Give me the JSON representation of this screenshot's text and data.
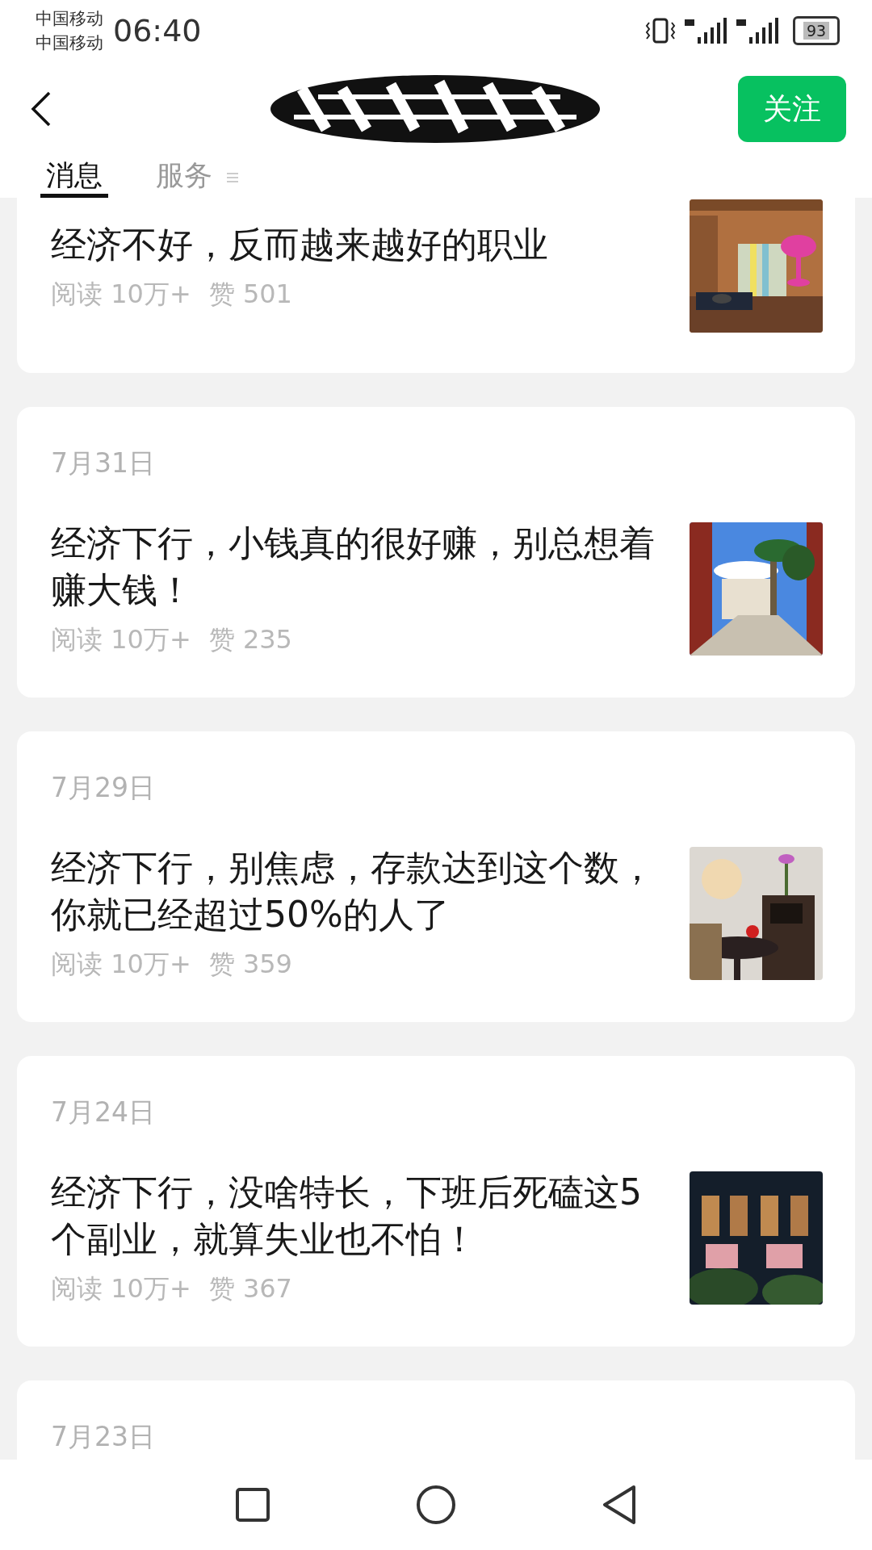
{
  "status_bar": {
    "carriers": [
      "中国移动",
      "中国移动"
    ],
    "time": "06:40",
    "battery": "93"
  },
  "header": {
    "follow_button": "关注"
  },
  "tabs": [
    {
      "label": "消息",
      "selected": true,
      "has_menu": false
    },
    {
      "label": "服务",
      "selected": false,
      "has_menu": true
    }
  ],
  "articles": [
    {
      "title": "经济不好，反而越来越好的职业",
      "reads": "阅读 10万+",
      "likes": "赞 501"
    },
    {
      "date": "7月31日",
      "title": "经济下行，小钱真的很好赚，别总想着赚大钱！",
      "reads": "阅读 10万+",
      "likes": "赞 235"
    },
    {
      "date": "7月29日",
      "title": "经济下行，别焦虑，存款达到这个数，你就已经超过50%的人了",
      "reads": "阅读 10万+",
      "likes": "赞 359"
    },
    {
      "date": "7月24日",
      "title": "经济下行，没啥特长，下班后死磕这5个副业，就算失业也不怕！",
      "reads": "阅读 10万+",
      "likes": "赞 367"
    },
    {
      "date": "7月23日"
    }
  ]
}
